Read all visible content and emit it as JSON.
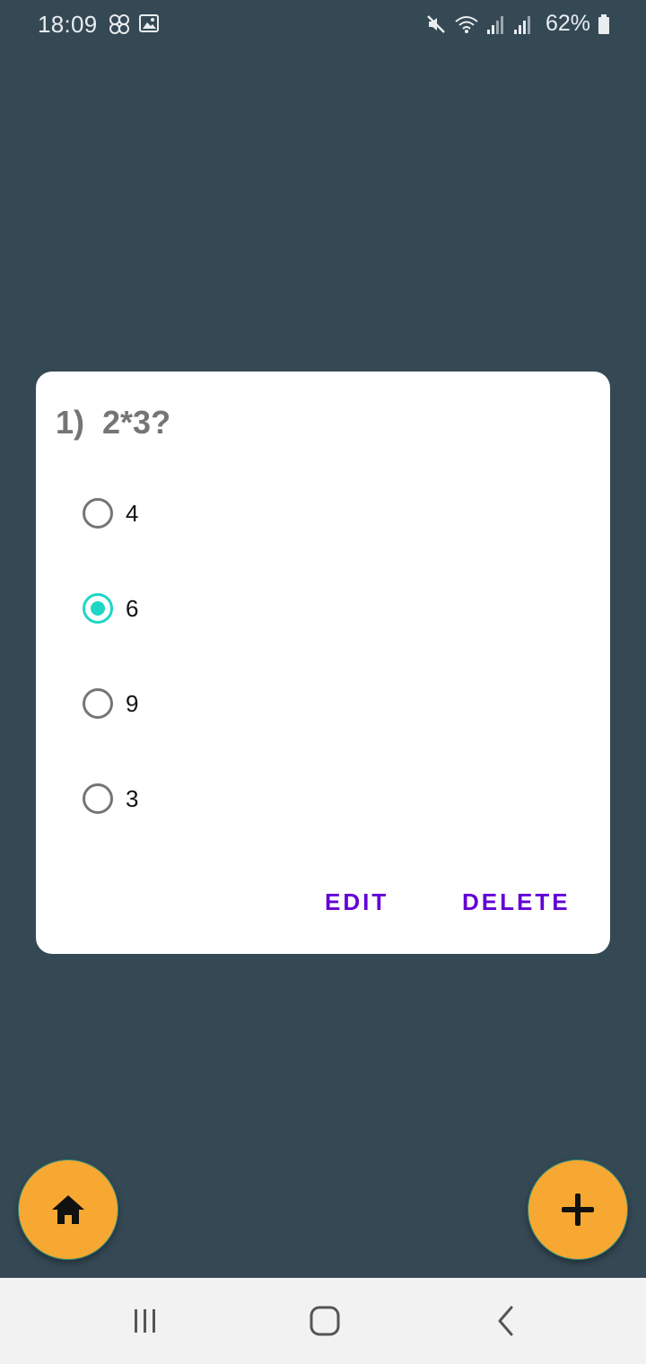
{
  "status_bar": {
    "time": "18:09",
    "battery_percent": "62%",
    "left_icons": [
      "cluster-icon",
      "gallery-icon"
    ],
    "right_icons": [
      "mute-icon",
      "wifi-icon",
      "signal-icon",
      "signal-icon",
      "battery-icon"
    ]
  },
  "question_card": {
    "number": "1)",
    "question": "2*3?",
    "options": [
      {
        "label": "4",
        "selected": false
      },
      {
        "label": "6",
        "selected": true
      },
      {
        "label": "9",
        "selected": false
      },
      {
        "label": "3",
        "selected": false
      }
    ],
    "edit_label": "EDIT",
    "delete_label": "DELETE"
  },
  "fabs": {
    "home_icon": "home-icon",
    "add_icon": "plus-icon"
  },
  "nav_bar": {
    "icons": [
      "recent-apps-icon",
      "home-nav-icon",
      "back-icon"
    ]
  },
  "colors": {
    "background": "#354955",
    "card": "#ffffff",
    "accent_radio": "#1dd6c6",
    "button_text": "#6200d6",
    "fab": "#f6a832"
  }
}
